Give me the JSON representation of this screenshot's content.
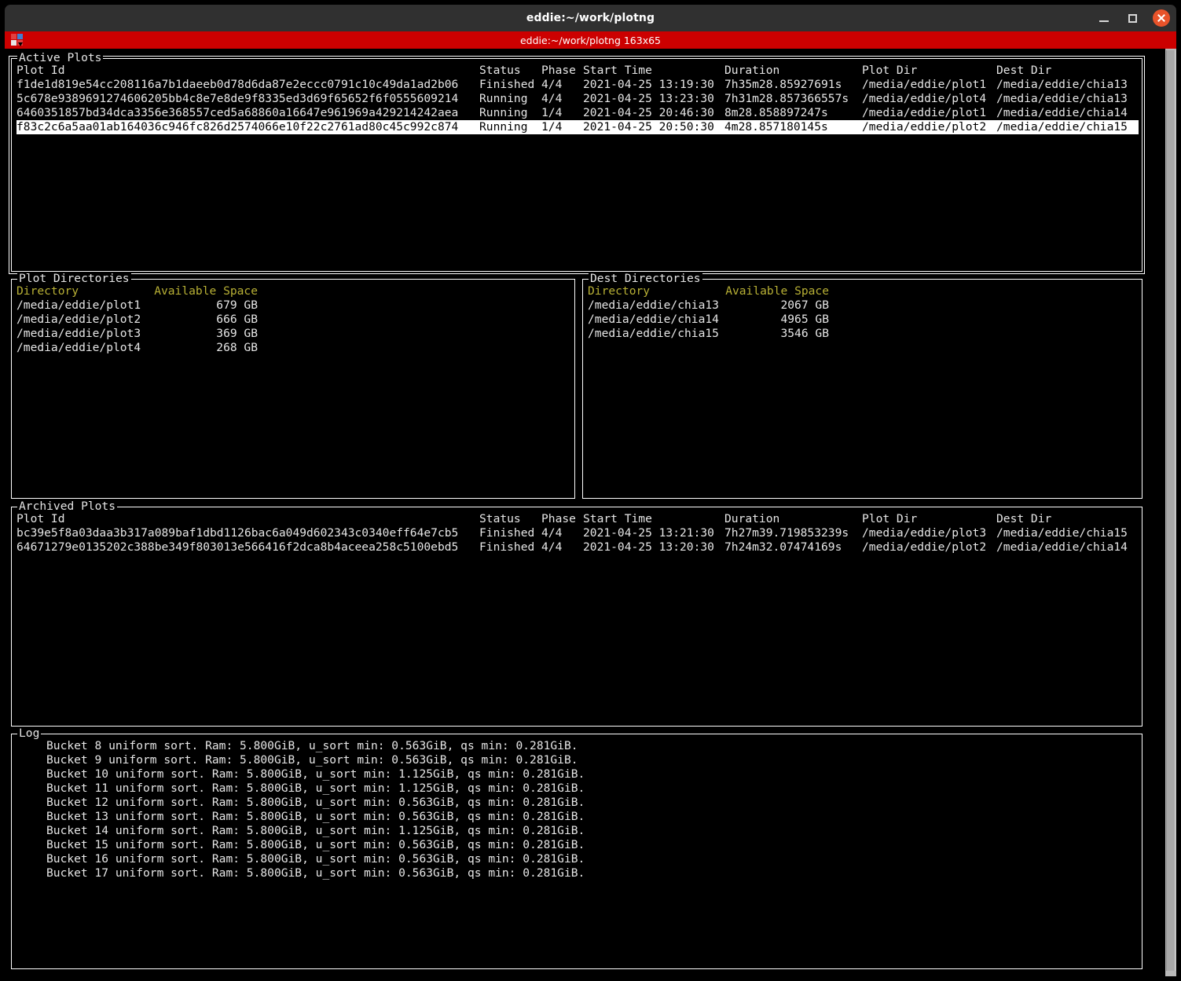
{
  "window": {
    "title": "eddie:~/work/plotng",
    "controls": {
      "minimize_label": "Minimize",
      "maximize_label": "Maximize",
      "close_label": "Close"
    }
  },
  "tabbar": {
    "tab_label": "eddie:~/work/plotng 163x65",
    "list_icon": "tab-list-icon"
  },
  "colors": {
    "titlebar_bg": "#303030",
    "tabbar_bg": "#cc0000",
    "terminal_bg": "#000000",
    "text": "#e6e6e6",
    "header_yellow": "#b8b035",
    "close_button": "#e8532a",
    "selection_bg": "#ffffff",
    "selection_fg": "#000000",
    "scrollbar": "#b8b8b8"
  },
  "active_plots": {
    "title": "Active Plots",
    "columns": {
      "id": "Plot Id",
      "status": "Status",
      "phase": "Phase",
      "start_time": "Start Time",
      "duration": "Duration",
      "plot_dir": "Plot Dir",
      "dest_dir": "Dest Dir"
    },
    "rows": [
      {
        "id": "f1de1d819e54cc208116a7b1daeeb0d78d6da87e2eccc0791c10c49da1ad2b06",
        "status": "Finished",
        "phase": "4/4",
        "start_time": "2021-04-25 13:19:30",
        "duration": "7h35m28.85927691s",
        "plot_dir": "/media/eddie/plot1",
        "dest_dir": "/media/eddie/chia13",
        "selected": false
      },
      {
        "id": "5c678e9389691274606205bb4c8e7e8de9f8335ed3d69f65652f6f0555609214",
        "status": "Running",
        "phase": "4/4",
        "start_time": "2021-04-25 13:23:30",
        "duration": "7h31m28.857366557s",
        "plot_dir": "/media/eddie/plot4",
        "dest_dir": "/media/eddie/chia13",
        "selected": false
      },
      {
        "id": "6460351857bd34dca3356e368557ced5a68860a16647e961969a429214242aea",
        "status": "Running",
        "phase": "1/4",
        "start_time": "2021-04-25 20:46:30",
        "duration": "8m28.858897247s",
        "plot_dir": "/media/eddie/plot1",
        "dest_dir": "/media/eddie/chia14",
        "selected": false
      },
      {
        "id": "f83c2c6a5aa01ab164036c946fc826d2574066e10f22c2761ad80c45c992c874",
        "status": "Running",
        "phase": "1/4",
        "start_time": "2021-04-25 20:50:30",
        "duration": "4m28.857180145s",
        "plot_dir": "/media/eddie/plot2",
        "dest_dir": "/media/eddie/chia15",
        "selected": true
      }
    ]
  },
  "plot_directories": {
    "title": "Plot Directories",
    "columns": {
      "directory": "Directory",
      "available_space": "Available Space"
    },
    "rows": [
      {
        "directory": "/media/eddie/plot1",
        "available_space": "679 GB"
      },
      {
        "directory": "/media/eddie/plot2",
        "available_space": "666 GB"
      },
      {
        "directory": "/media/eddie/plot3",
        "available_space": "369 GB"
      },
      {
        "directory": "/media/eddie/plot4",
        "available_space": "268 GB"
      }
    ]
  },
  "dest_directories": {
    "title": "Dest Directories",
    "columns": {
      "directory": "Directory",
      "available_space": "Available Space"
    },
    "rows": [
      {
        "directory": "/media/eddie/chia13",
        "available_space": "2067 GB"
      },
      {
        "directory": "/media/eddie/chia14",
        "available_space": "4965 GB"
      },
      {
        "directory": "/media/eddie/chia15",
        "available_space": "3546 GB"
      }
    ]
  },
  "archived_plots": {
    "title": "Archived Plots",
    "columns": {
      "id": "Plot Id",
      "status": "Status",
      "phase": "Phase",
      "start_time": "Start Time",
      "duration": "Duration",
      "plot_dir": "Plot Dir",
      "dest_dir": "Dest Dir"
    },
    "rows": [
      {
        "id": "bc39e5f8a03daa3b317a089baf1dbd1126bac6a049d602343c0340eff64e7cb5",
        "status": "Finished",
        "phase": "4/4",
        "start_time": "2021-04-25 13:21:30",
        "duration": "7h27m39.719853239s",
        "plot_dir": "/media/eddie/plot3",
        "dest_dir": "/media/eddie/chia15"
      },
      {
        "id": "64671279e0135202c388be349f803013e566416f2dca8b4aceea258c5100ebd5",
        "status": "Finished",
        "phase": "4/4",
        "start_time": "2021-04-25 13:20:30",
        "duration": "7h24m32.07474169s",
        "plot_dir": "/media/eddie/plot2",
        "dest_dir": "/media/eddie/chia14"
      }
    ]
  },
  "log": {
    "title": "Log",
    "lines": [
      "Bucket 8 uniform sort. Ram: 5.800GiB, u_sort min: 0.563GiB, qs min: 0.281GiB.",
      "Bucket 9 uniform sort. Ram: 5.800GiB, u_sort min: 0.563GiB, qs min: 0.281GiB.",
      "Bucket 10 uniform sort. Ram: 5.800GiB, u_sort min: 1.125GiB, qs min: 0.281GiB.",
      "Bucket 11 uniform sort. Ram: 5.800GiB, u_sort min: 1.125GiB, qs min: 0.281GiB.",
      "Bucket 12 uniform sort. Ram: 5.800GiB, u_sort min: 0.563GiB, qs min: 0.281GiB.",
      "Bucket 13 uniform sort. Ram: 5.800GiB, u_sort min: 0.563GiB, qs min: 0.281GiB.",
      "Bucket 14 uniform sort. Ram: 5.800GiB, u_sort min: 1.125GiB, qs min: 0.281GiB.",
      "Bucket 15 uniform sort. Ram: 5.800GiB, u_sort min: 0.563GiB, qs min: 0.281GiB.",
      "Bucket 16 uniform sort. Ram: 5.800GiB, u_sort min: 0.563GiB, qs min: 0.281GiB.",
      "Bucket 17 uniform sort. Ram: 5.800GiB, u_sort min: 0.563GiB, qs min: 0.281GiB."
    ]
  }
}
